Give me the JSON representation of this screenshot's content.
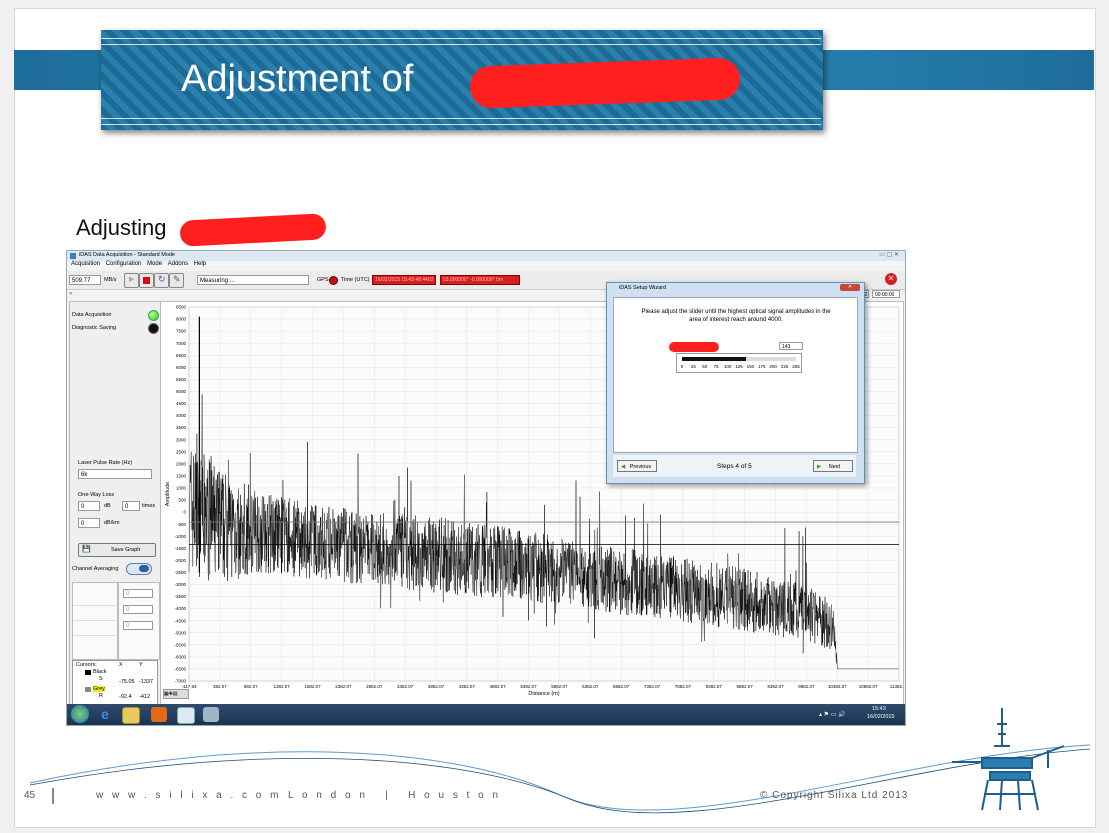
{
  "slide": {
    "title": "Adjustment of",
    "subtitle": "Adjusting",
    "page_number": "45",
    "website": "w w w . s i l i x a . c o m",
    "locations": "L o n d o n   |   H o u s t o n",
    "copyright": "© Copyright Silixa Ltd  2013"
  },
  "app": {
    "window_title": "iDAS Data Acquisition - Standard Mode",
    "menu": [
      "Acquisition",
      "Configuration",
      "Mode",
      "Addons",
      "Help"
    ],
    "rate_value": "509.77",
    "rate_unit": "MB/s",
    "status": "Measuring ...",
    "gps_label": "GPS",
    "time_label": "Time (UTC)",
    "time_value": "16/02/2015 15:43:48.4403",
    "position_value": "53.000000° -0.000000° 0m",
    "small_time_a": "22",
    "small_time_b": "00:00:00"
  },
  "panel": {
    "data_acquisition": "Data Acquisition",
    "diagnostic_saving": "Diagnostic Saving",
    "laser_rate_label": "Laser Pulse Rate (Hz)",
    "laser_rate_value": "6k",
    "one_way_loss": "One-Way Loss",
    "loss_value_1": "0",
    "loss_unit_1": "dB",
    "loss_value_2": "0",
    "loss_unit_2": "times",
    "loss_value_3": "0",
    "loss_unit_3": "dB/km",
    "save_graph": "Save Graph",
    "channel_averaging": "Channel Averaging",
    "avg_fields": [
      "0",
      "0",
      "0"
    ],
    "cursors_title": "Cursors:",
    "cursor_x": "X",
    "cursor_y": "Y",
    "cursor1_name": "Black",
    "cursor1_tag": "S",
    "cursor1_x": "-75.05",
    "cursor1_y": "-1337",
    "cursor2_name": "Grey",
    "cursor2_tag": "R",
    "cursor2_x": "-92.4",
    "cursor2_y": "-412"
  },
  "wizard": {
    "title": "iDAS Setup Wizard",
    "instruction": "Please adjust the slider until the highest optical signal amplitudes in the area of interest reach around 4000.",
    "slider_value": "143",
    "slider_ticks": [
      "0",
      "25",
      "50",
      "75",
      "100",
      "125",
      "150",
      "175",
      "200",
      "225",
      "255"
    ],
    "slider_level": 143,
    "slider_max": 255,
    "previous": "Previous",
    "next": "Next",
    "steps": "Steps 4 of 5"
  },
  "taskbar": {
    "time": "15:43",
    "date": "16/02/2015"
  },
  "chart_data": {
    "type": "line",
    "xlabel": "Distance (m)",
    "ylabel": "Amplitude",
    "xlim": [
      -117.93,
      11382.07
    ],
    "ylim": [
      -7000,
      8500
    ],
    "x_ticks": [
      "-117.93",
      "382.07",
      "882.07",
      "1382.07",
      "1882.07",
      "2382.07",
      "2882.07",
      "3382.07",
      "3882.07",
      "4382.07",
      "4882.07",
      "5382.07",
      "5882.07",
      "6382.07",
      "6882.07",
      "7382.07",
      "7882.07",
      "8382.07",
      "8882.07",
      "9382.07",
      "9882.07",
      "10382.07",
      "10882.07",
      "11382.07"
    ],
    "y_ticks": [
      "8500",
      "8000",
      "7500",
      "7000",
      "6500",
      "6000",
      "5500",
      "5000",
      "4500",
      "4000",
      "3500",
      "3000",
      "2500",
      "2000",
      "1500",
      "1000",
      "500",
      "0",
      "-500",
      "-1000",
      "-1500",
      "-2000",
      "-2500",
      "-3000",
      "-3500",
      "-4000",
      "-4500",
      "-5000",
      "-5500",
      "-6000",
      "-6500",
      "-7000"
    ],
    "cursor_lines": [
      -412,
      -1337
    ],
    "signal_envelope": {
      "x": [
        -117.93,
        300,
        1000,
        2000,
        3000,
        4000,
        5000,
        6000,
        7000,
        8000,
        9000,
        10000,
        10300,
        10382.07,
        10882.07,
        11382.07
      ],
      "upper": [
        3000,
        2000,
        900,
        300,
        0,
        -200,
        -600,
        -1100,
        -1500,
        -1900,
        -2400,
        -3100,
        -3500,
        -6200,
        -6500,
        -6500
      ],
      "lower": [
        -2500,
        -3000,
        -2500,
        -2800,
        -3100,
        -3400,
        -3600,
        -3900,
        -4300,
        -4600,
        -5000,
        -5500,
        -5700,
        -6500,
        -6500,
        -6500
      ]
    }
  }
}
